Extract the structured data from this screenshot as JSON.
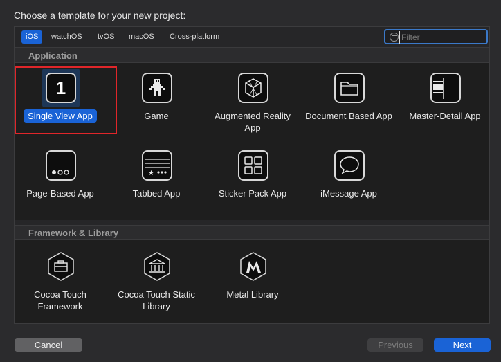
{
  "heading": "Choose a template for your new project:",
  "tabs": [
    "iOS",
    "watchOS",
    "tvOS",
    "macOS",
    "Cross-platform"
  ],
  "selected_tab": "iOS",
  "filter": {
    "placeholder": "Filter",
    "value": ""
  },
  "sections": {
    "application": {
      "title": "Application",
      "items": [
        {
          "label": "Single View App",
          "icon": "single-view-icon",
          "glyph": "1",
          "selected": true
        },
        {
          "label": "Game",
          "icon": "game-icon"
        },
        {
          "label": "Augmented Reality App",
          "icon": "ar-cube-icon"
        },
        {
          "label": "Document Based App",
          "icon": "folder-icon"
        },
        {
          "label": "Master-Detail App",
          "icon": "master-detail-icon"
        },
        {
          "label": "Page-Based App",
          "icon": "page-dots-icon"
        },
        {
          "label": "Tabbed App",
          "icon": "tab-bar-icon"
        },
        {
          "label": "Sticker Pack App",
          "icon": "grid-icon"
        },
        {
          "label": "iMessage App",
          "icon": "speech-bubble-icon"
        }
      ]
    },
    "framework": {
      "title": "Framework & Library",
      "items": [
        {
          "label": "Cocoa Touch Framework",
          "icon": "toolbox-icon"
        },
        {
          "label": "Cocoa Touch Static Library",
          "icon": "library-building-icon"
        },
        {
          "label": "Metal Library",
          "icon": "metal-icon"
        }
      ]
    }
  },
  "buttons": {
    "cancel": "Cancel",
    "previous": "Previous",
    "next": "Next"
  },
  "colors": {
    "accent": "#1a63d6",
    "highlight": "#e0262a",
    "background": "#1e1e1e"
  }
}
